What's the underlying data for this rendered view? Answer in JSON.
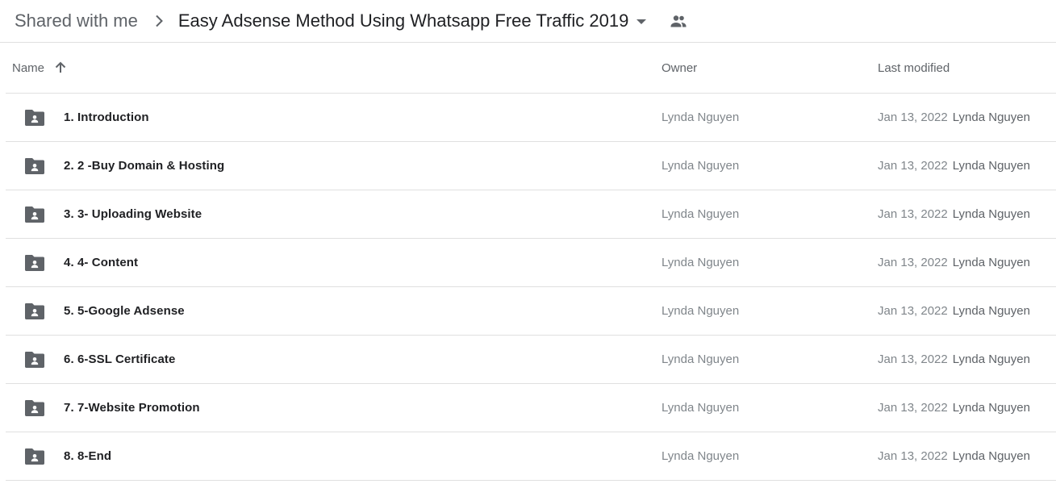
{
  "breadcrumb": {
    "root": "Shared with me",
    "current": "Easy Adsense Method Using Whatsapp Free Traffic 2019"
  },
  "columns": {
    "name": "Name",
    "owner": "Owner",
    "modified": "Last modified"
  },
  "icons": {
    "separator": "chevron-right-icon",
    "dropdown": "caret-down-icon",
    "shared": "people-icon",
    "sort": "arrow-up-icon",
    "folder": "shared-folder-icon"
  },
  "colors": {
    "icon": "#5f6368",
    "divider": "#e0e0e0"
  },
  "rows": [
    {
      "name": "1. Introduction",
      "owner": "Lynda Nguyen",
      "date": "Jan 13, 2022",
      "modified_by": "Lynda Nguyen"
    },
    {
      "name": "2. 2 -Buy Domain & Hosting",
      "owner": "Lynda Nguyen",
      "date": "Jan 13, 2022",
      "modified_by": "Lynda Nguyen"
    },
    {
      "name": "3. 3- Uploading Website",
      "owner": "Lynda Nguyen",
      "date": "Jan 13, 2022",
      "modified_by": "Lynda Nguyen"
    },
    {
      "name": "4. 4- Content",
      "owner": "Lynda Nguyen",
      "date": "Jan 13, 2022",
      "modified_by": "Lynda Nguyen"
    },
    {
      "name": "5. 5-Google Adsense",
      "owner": "Lynda Nguyen",
      "date": "Jan 13, 2022",
      "modified_by": "Lynda Nguyen"
    },
    {
      "name": "6. 6-SSL Certificate",
      "owner": "Lynda Nguyen",
      "date": "Jan 13, 2022",
      "modified_by": "Lynda Nguyen"
    },
    {
      "name": "7. 7-Website Promotion",
      "owner": "Lynda Nguyen",
      "date": "Jan 13, 2022",
      "modified_by": "Lynda Nguyen"
    },
    {
      "name": "8. 8-End",
      "owner": "Lynda Nguyen",
      "date": "Jan 13, 2022",
      "modified_by": "Lynda Nguyen"
    }
  ]
}
